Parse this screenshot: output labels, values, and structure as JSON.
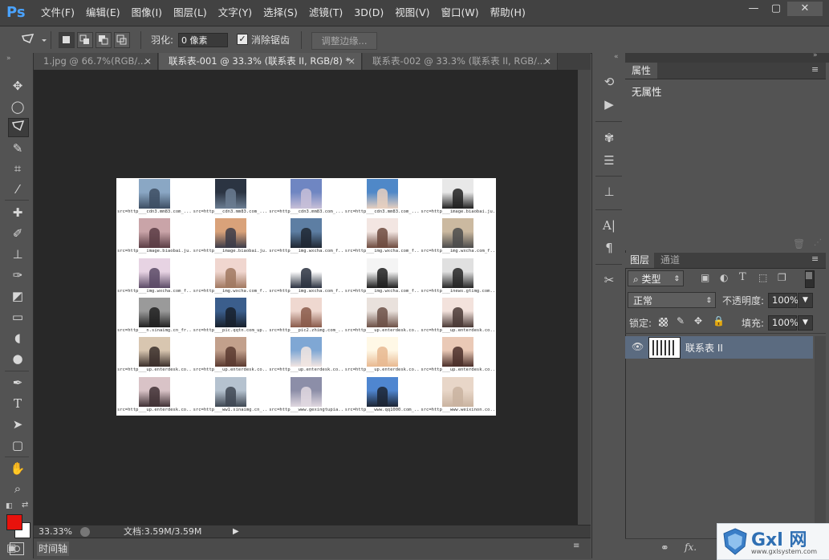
{
  "app": {
    "logo": "Ps"
  },
  "menu": [
    "文件(F)",
    "编辑(E)",
    "图像(I)",
    "图层(L)",
    "文字(Y)",
    "选择(S)",
    "滤镜(T)",
    "3D(D)",
    "视图(V)",
    "窗口(W)",
    "帮助(H)"
  ],
  "window_controls": {
    "minimize": "—",
    "restore": "▢",
    "close": "✕"
  },
  "options": {
    "feather_label": "羽化:",
    "feather_value": "0 像素",
    "antialias_label": "消除锯齿",
    "refine_edge": "调整边缘..."
  },
  "tabs": [
    {
      "label": "1.jpg @ 66.7%(RGB/...",
      "close": "×"
    },
    {
      "label": "联系表-001 @ 33.3% (联系表 II, RGB/8) *",
      "close": "×"
    },
    {
      "label": "联系表-002 @ 33.3% (联系表 II, RGB/...",
      "close": "×"
    }
  ],
  "contact_sheet": {
    "captions": [
      [
        "src=http___cdn3.mm83.com_...",
        "src=http___cdn3.mm83.com_...",
        "src=http___cdn3.mm83.com_...",
        "src=http___cdn3.mm83.com_...",
        "src=http___image.biaobai.ju..."
      ],
      [
        "src=http___image.biaobai.ju...",
        "src=http___image.biaobai.ju...",
        "src=http___img.wxcha.com_f...",
        "src=http___img.wxcha.com_f...",
        "src=http___img.wxcha.com_f..."
      ],
      [
        "src=http___img.wxcha.com_f...",
        "src=http___img.wxcha.com_f...",
        "src=http___img.wxcha.com_f...",
        "src=http___img.wxcha.com_f...",
        "src=http___inews.gtimg.com..."
      ],
      [
        "src=http___n.sinaimg.cn_fr...",
        "src=http___pic.qqtn.com_up...",
        "src=http___pic2.zhimg.com_...",
        "src=http___up.enterdesk.co...",
        "src=http___up.enterdesk.co..."
      ],
      [
        "src=http___up.enterdesk.co...",
        "src=http___up.enterdesk.co...",
        "src=http___up.enterdesk.co...",
        "src=http___up.enterdesk.co...",
        "src=http___up.enterdesk.co..."
      ],
      [
        "src=http___up.enterdesk.co...",
        "src=http___ww1.sinaimg.cn_...",
        "src=http___www.gexingtupia...",
        "src=http___www.qq1000.com_...",
        "src=http___www.weixinon.co..."
      ]
    ]
  },
  "status": {
    "zoom": "33.33%",
    "doc": "文档:3.59M/3.59M"
  },
  "timeline": {
    "label": "时间轴"
  },
  "properties": {
    "tab": "属性",
    "empty": "无属性"
  },
  "layers": {
    "tab_layers": "图层",
    "tab_channels": "通道",
    "filter_kind": "类型",
    "blend_mode": "正常",
    "opacity_label": "不透明度:",
    "opacity_value": "100%",
    "lock_label": "锁定:",
    "fill_label": "填充:",
    "fill_value": "100%",
    "layer_name": "联系表 II"
  },
  "watermark": {
    "brand": "Gxl 网",
    "url": "www.gxlsystem.com"
  },
  "colors": {
    "foreground": "#e8120c",
    "background": "#ffffff"
  }
}
